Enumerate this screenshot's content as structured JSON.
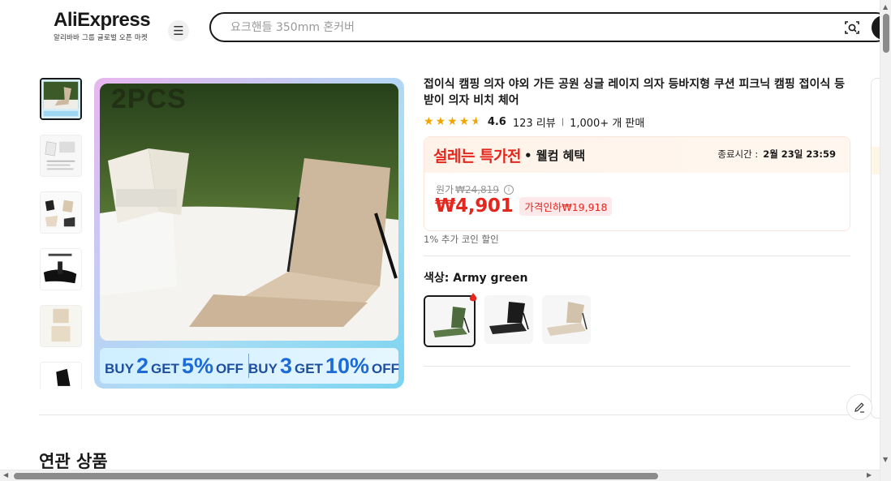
{
  "header": {
    "logo": "AliExpress",
    "logo_sub": "알리바바 그룹 글로벌 오픈 마켓",
    "search_placeholder": "요크핸들 350mm 혼커버"
  },
  "gallery": {
    "thumbnails": [
      "thumb-1",
      "thumb-2",
      "thumb-3",
      "thumb-4",
      "thumb-5",
      "thumb-6"
    ],
    "main_overlay_text": "2PCS",
    "banner": {
      "left": {
        "buy": "BUY",
        "qty": "2",
        "get": "GET",
        "pct": "5%",
        "off": "OFF"
      },
      "right": {
        "buy": "BUY",
        "qty": "3",
        "get": "GET",
        "pct": "10%",
        "off": "OFF"
      }
    }
  },
  "product": {
    "title": "접이식 캠핑 의자 야외 가든 공원 싱글 레이지 의자 등바지형 쿠션 피크닉 캠핑 접이식 등받이 의자 비치 체어",
    "rating": "4.6",
    "reviews": "123 리뷰",
    "sold": "1,000+ 개 판매",
    "stars_filled": 4.6
  },
  "pricing": {
    "promo_title": "설레는 특가전",
    "promo_sub": "• 웰컴 혜택",
    "ends_label": "종료시간 :",
    "ends_value": "2월 23일 23:59",
    "original_label": "원가",
    "original_price": "₩24,819",
    "price": "₩4,901",
    "discount": "가격인하₩19,918",
    "coin_note": "1% 추가 코인 할인"
  },
  "variants": {
    "label": "색상: ",
    "selected": "Army green",
    "options": [
      "army-green",
      "black",
      "khaki"
    ]
  },
  "sections": {
    "related": "연관 상품"
  },
  "colors": {
    "accent_red": "#e4261d",
    "star": "#f0a500",
    "brand_dark": "#191919"
  }
}
